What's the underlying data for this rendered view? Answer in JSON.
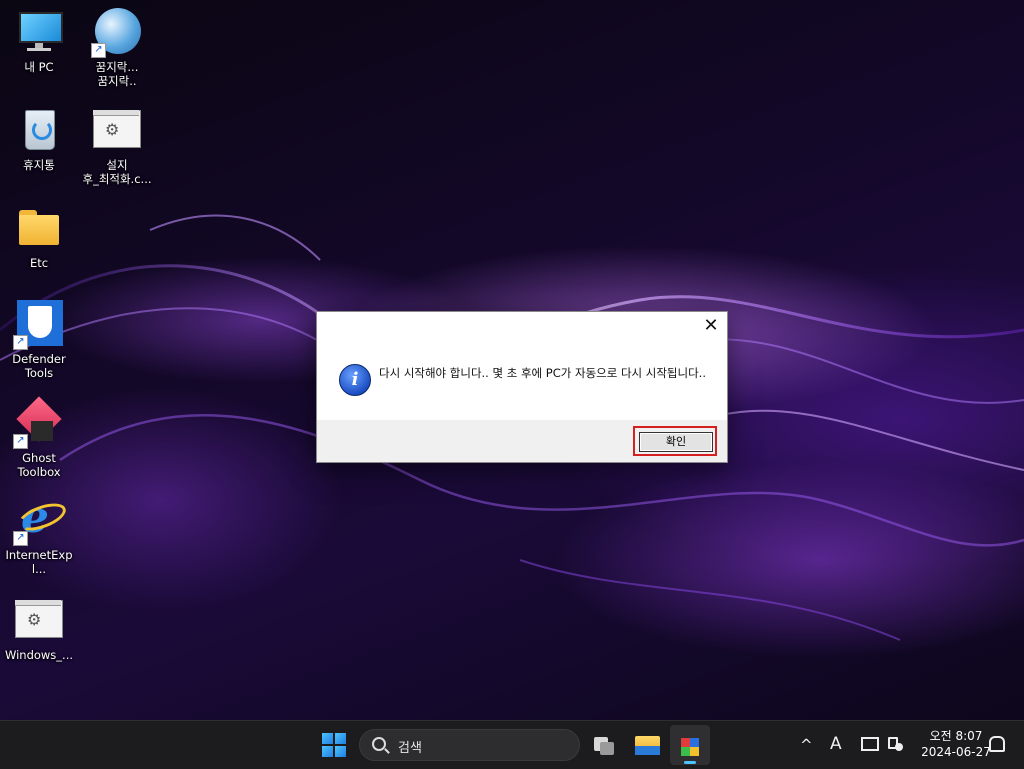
{
  "desktop": {
    "icons": [
      {
        "label": "내 PC"
      },
      {
        "label": "꿈지락...\n꿈지락.."
      },
      {
        "label": "휴지통"
      },
      {
        "label": "설지\n후_최적화.c..."
      },
      {
        "label": "Etc"
      },
      {
        "label": "Defender\nTools"
      },
      {
        "label": "Ghost\nToolbox"
      },
      {
        "label": "InternetExpl..."
      },
      {
        "label": "Windows_..."
      }
    ]
  },
  "dialog": {
    "close_label": "✕",
    "info_glyph": "i",
    "message": "다시 시작해야 합니다.. 몇 초 후에 PC가 자동으로 다시 시작됩니다..",
    "ok_label": "확인",
    "highlight_color": "#d42020"
  },
  "taskbar": {
    "search_placeholder": "검색",
    "tray": {
      "chevron": "^",
      "ime": "A",
      "clock_time": "오전 8:07",
      "clock_date": "2024-06-27"
    }
  }
}
